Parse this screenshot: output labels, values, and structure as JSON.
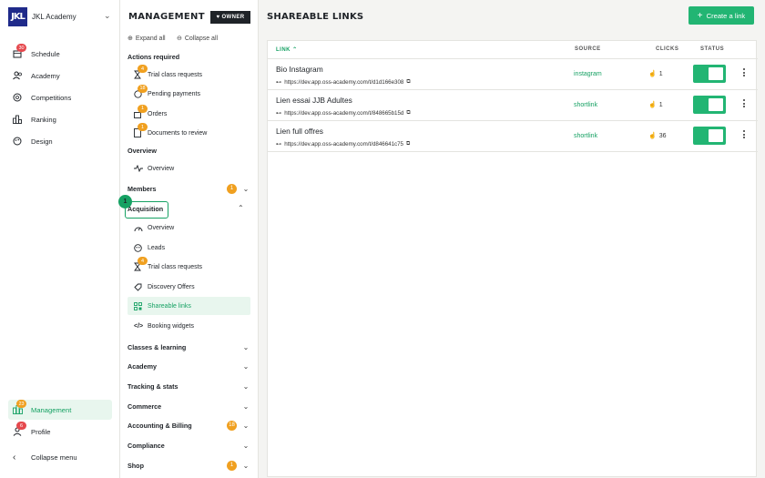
{
  "academy": {
    "logo": "JKL",
    "name": "JKL Academy"
  },
  "leftnav": {
    "items": [
      {
        "label": "Schedule",
        "icon": "calendar-icon",
        "badge": "30"
      },
      {
        "label": "Academy",
        "icon": "users-icon"
      },
      {
        "label": "Competitions",
        "icon": "trophy-icon"
      },
      {
        "label": "Ranking",
        "icon": "ranking-icon"
      },
      {
        "label": "Design",
        "icon": "palette-icon"
      }
    ],
    "bottom": [
      {
        "label": "Management",
        "icon": "management-icon",
        "badge": "23"
      },
      {
        "label": "Profile",
        "icon": "profile-icon",
        "badge": "6"
      },
      {
        "label": "Collapse menu",
        "icon": "chevron-left-icon"
      }
    ]
  },
  "management": {
    "title": "MANAGEMENT",
    "owner_badge": "OWNER",
    "expand_all": "Expand all",
    "collapse_all": "Collapse all",
    "actions_required": {
      "title": "Actions required",
      "items": [
        {
          "label": "Trial class requests",
          "badge": "4"
        },
        {
          "label": "Pending payments",
          "badge": "18"
        },
        {
          "label": "Orders",
          "badge": "1"
        },
        {
          "label": "Documents to review",
          "badge": "1"
        }
      ]
    },
    "overview": {
      "title": "Overview",
      "item": "Overview"
    },
    "members": {
      "label": "Members",
      "count": "1"
    },
    "acquisition": {
      "label": "Acquisition",
      "step": "1",
      "items": [
        {
          "label": "Overview"
        },
        {
          "label": "Leads"
        },
        {
          "label": "Trial class requests",
          "badge": "4"
        },
        {
          "label": "Discovery Offers"
        },
        {
          "label": "Shareable links"
        },
        {
          "label": "Booking widgets"
        }
      ]
    },
    "groups": [
      {
        "label": "Classes & learning"
      },
      {
        "label": "Academy"
      },
      {
        "label": "Tracking & stats"
      },
      {
        "label": "Commerce"
      },
      {
        "label": "Accounting & Billing",
        "count": "18"
      },
      {
        "label": "Compliance"
      },
      {
        "label": "Shop",
        "count": "1"
      }
    ]
  },
  "main": {
    "title": "SHAREABLE LINKS",
    "create_label": "Create a link",
    "columns": {
      "link": "LINK",
      "source": "SOURCE",
      "clicks": "CLICKS",
      "status": "STATUS"
    },
    "rows": [
      {
        "name": "Bio Instagram",
        "url": "https://dev.app.oss-academy.com/t/d1d166e308",
        "source": "instagram",
        "clicks": "1",
        "active": true
      },
      {
        "name": "Lien essai JJB Adultes",
        "url": "https://dev.app.oss-academy.com/t/848665b15d",
        "source": "shortlink",
        "clicks": "1",
        "active": true
      },
      {
        "name": "Lien full offres",
        "url": "https://dev.app.oss-academy.com/t/d846641c75",
        "source": "shortlink",
        "clicks": "36",
        "active": true
      }
    ]
  },
  "colors": {
    "accent": "#22b573",
    "brand": "#1f2a8a",
    "badge_red": "#e5484d",
    "badge_orange": "#f0a020"
  }
}
